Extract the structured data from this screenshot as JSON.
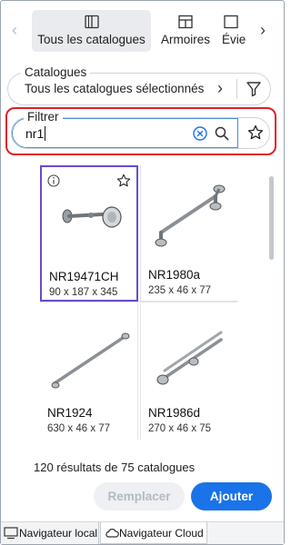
{
  "tabs": [
    {
      "label": "Tous les catalogues",
      "icon": "book-icon",
      "active": true
    },
    {
      "label": "Armoires",
      "icon": "cabinet-icon",
      "active": false
    },
    {
      "label": "Évie",
      "icon": "sink-icon",
      "active": false
    }
  ],
  "catalogues": {
    "label": "Catalogues",
    "value": "Tous les catalogues sélectionnés"
  },
  "filter": {
    "label": "Filtrer",
    "value": "nr1"
  },
  "products": [
    {
      "name": "NR19471CH",
      "dims": "90 x  187 x  345",
      "selected": true
    },
    {
      "name": "NR1980a",
      "dims": "235 x  46 x  77",
      "selected": false
    },
    {
      "name": "NR1924",
      "dims": "630 x  46 x  77",
      "selected": false
    },
    {
      "name": "NR1986d",
      "dims": "270 x  46 x  75",
      "selected": false
    }
  ],
  "results_text": "120 résultats de 75 catalogues",
  "buttons": {
    "replace": "Remplacer",
    "add": "Ajouter"
  },
  "bottom_tabs": [
    {
      "label": "Navigateur local",
      "active": false
    },
    {
      "label": "Navigateur Cloud",
      "active": true
    }
  ],
  "colors": {
    "accent": "#1a73e8",
    "selection": "#6a4ccc",
    "highlight_outline": "#e0202a"
  }
}
